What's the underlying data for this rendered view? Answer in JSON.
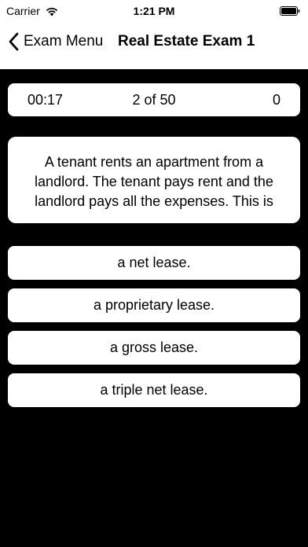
{
  "status_bar": {
    "carrier": "Carrier",
    "time": "1:21 PM"
  },
  "nav": {
    "back_label": "Exam Menu",
    "title": "Real Estate Exam 1"
  },
  "stats": {
    "timer": "00:17",
    "progress": "2 of 50",
    "score": "0"
  },
  "question": {
    "text": "A tenant rents an apartment from a landlord. The tenant pays rent and the landlord pays all the expenses. This is"
  },
  "answers": [
    {
      "label": "a net lease."
    },
    {
      "label": "a proprietary lease."
    },
    {
      "label": "a gross lease."
    },
    {
      "label": "a triple net lease."
    }
  ],
  "colors": {
    "background": "#000000",
    "card": "#ffffff",
    "text": "#000000"
  },
  "icons": [
    "wifi-icon",
    "battery-icon",
    "chevron-left-icon"
  ]
}
